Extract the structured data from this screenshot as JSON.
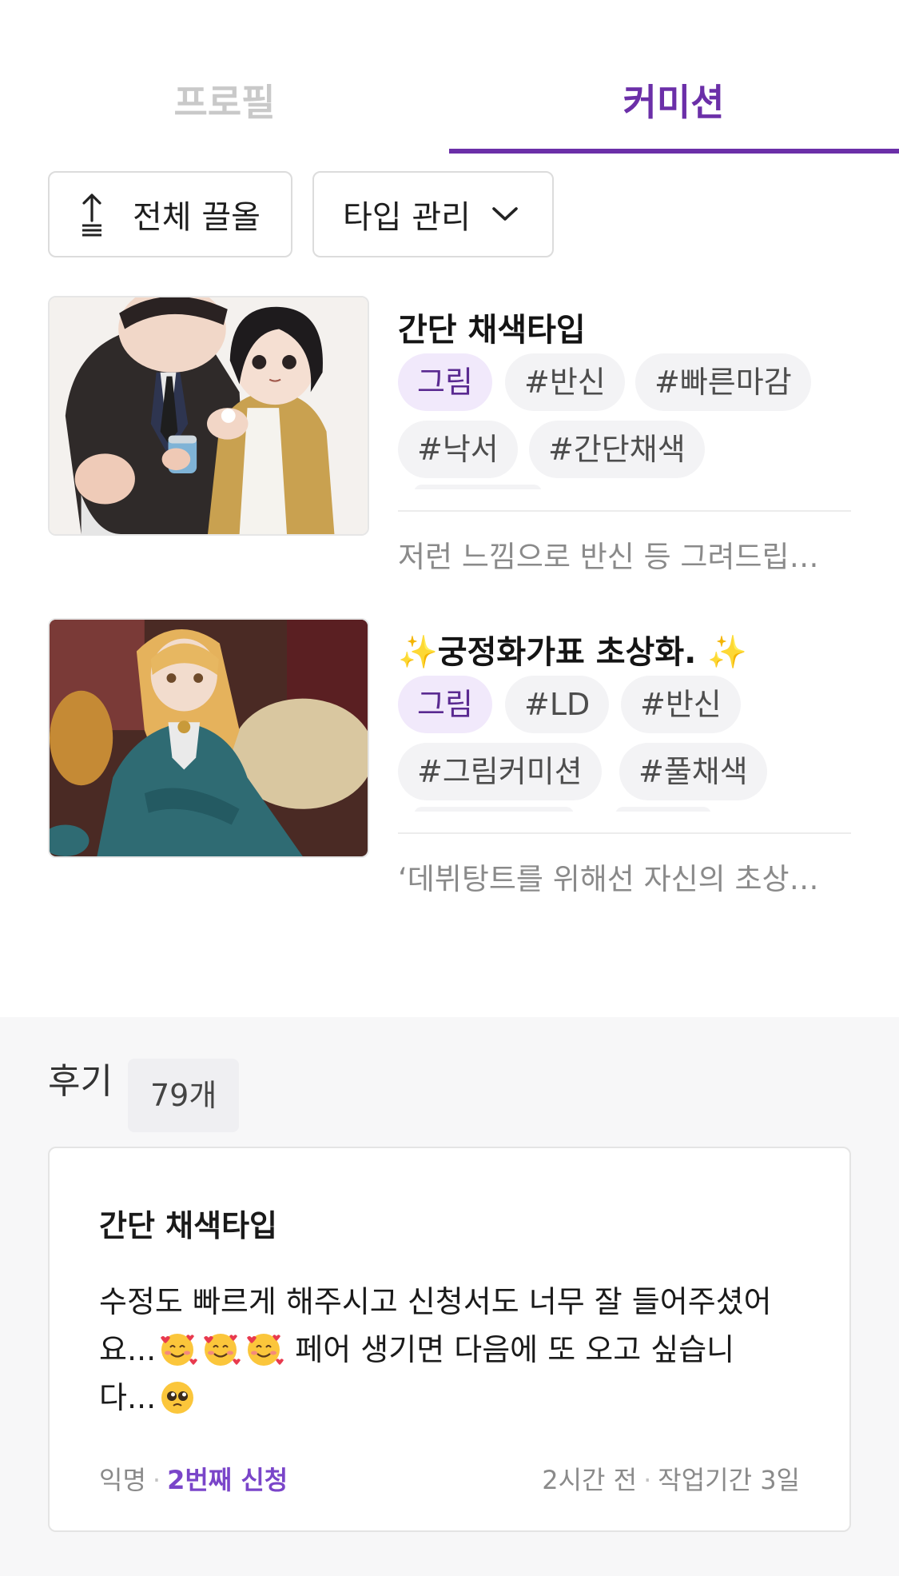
{
  "tabs": [
    {
      "label": "프로필",
      "active": false
    },
    {
      "label": "커미션",
      "active": true
    }
  ],
  "colors": {
    "accent": "#6b2fa8",
    "inactive_tab": "#c9c9c9",
    "tag_category_bg": "#f1e9fb"
  },
  "toolbar": {
    "pull_all_label": "전체 끌올",
    "pull_all_icon": "upload-arrow-icon",
    "type_manage_label": "타입 관리",
    "type_manage_icon": "chevron-down-icon"
  },
  "commissions": [
    {
      "title": "간단 채색타입",
      "category": "그림",
      "tags": [
        "#반신",
        "#빠른마감",
        "#낙서",
        "#간단채색"
      ],
      "description": "저런 느낌으로 반신 등 그려드립…",
      "thumbnail": "illustration-couple"
    },
    {
      "title": "✨궁정화가표 초상화. ✨",
      "category": "그림",
      "tags": [
        "#LD",
        "#반신",
        "#그림커미션",
        "#풀채색"
      ],
      "description": "‘데뷔탕트를 위해선 자신의 초상…",
      "thumbnail": "illustration-noble-lady"
    }
  ],
  "reviews": {
    "heading": "후기",
    "count": "79개",
    "items": [
      {
        "title": "간단 채색타입",
        "text_line1": "수정도 빠르게 해주시고 신청서도 너무 잘 들어주셨어",
        "text_line2a": "요...",
        "text_line2b": " 페어 생기면 다음에 또 오고 싶습니",
        "text_line3": "다...",
        "emojis": [
          "smiling-face-with-hearts",
          "smiling-face-with-hearts",
          "smiling-face-with-hearts",
          "pleading-face"
        ],
        "author": "익명",
        "order_count": "2번째 신청",
        "time": "2시간 전",
        "work_period": "작업기간 3일"
      }
    ]
  }
}
